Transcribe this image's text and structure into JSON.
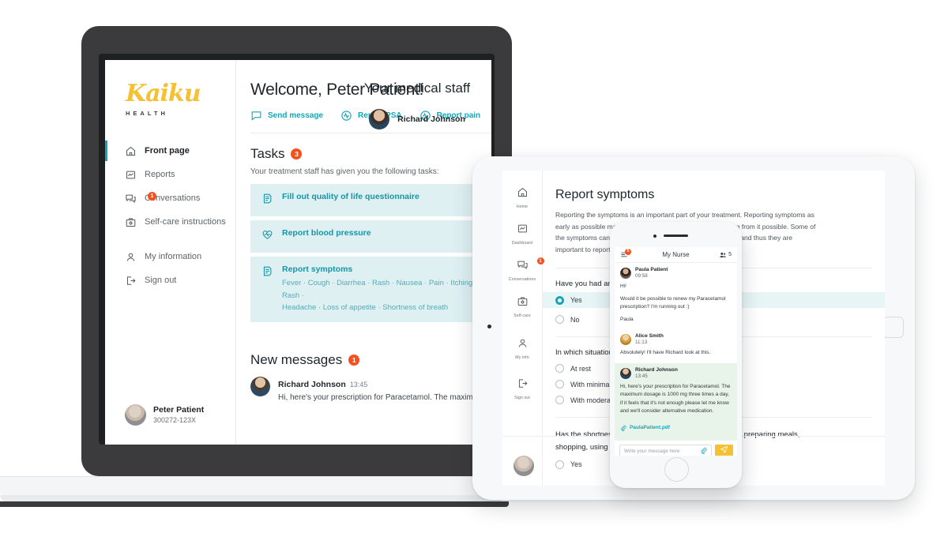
{
  "desktop": {
    "logo": {
      "name": "Kaiku",
      "sub": "HEALTH"
    },
    "nav": [
      {
        "label": "Front page",
        "icon": "home-icon",
        "active": true
      },
      {
        "label": "Reports",
        "icon": "chart-icon",
        "active": false
      },
      {
        "label": "Conversations",
        "icon": "chat-icon",
        "badge": "1",
        "active": false
      },
      {
        "label": "Self-care instructions",
        "icon": "briefcase-icon",
        "active": false
      },
      {
        "label": "My information",
        "icon": "person-icon",
        "active": false
      },
      {
        "label": "Sign out",
        "icon": "signout-icon",
        "active": false
      }
    ],
    "user": {
      "name": "Peter Patient",
      "id": "300272-123X"
    },
    "title": "Welcome, Peter Patient!",
    "actions": [
      {
        "label": "Send message",
        "icon": "message-icon"
      },
      {
        "label": "Report PSA",
        "icon": "pulse-icon"
      },
      {
        "label": "Report pain",
        "icon": "pulse-icon"
      }
    ],
    "tasks_section": {
      "title": "Tasks",
      "count": "3",
      "subtitle": "Your treatment staff has given you the following tasks:",
      "items": [
        {
          "name": "Fill out quality of life questionnaire",
          "icon": "document-icon",
          "symptoms": ""
        },
        {
          "name": "Report blood pressure",
          "icon": "heart-icon",
          "symptoms": ""
        },
        {
          "name": "Report symptoms",
          "icon": "document-icon",
          "symptoms": "Fever · Cough · Diarrhea · Rash · Nausea · Pain · Itching · Rash ·\nHeadache · Loss of appetite · Shortness of breath"
        }
      ]
    },
    "messages_section": {
      "title": "New messages",
      "count": "1",
      "items": [
        {
          "name": "Richard Johnson",
          "time": "13:45",
          "text": "Hi, here's your prescription for Paracetamol. The maxim"
        }
      ]
    },
    "staff_section": {
      "title": "Your medical staff",
      "members": [
        {
          "name": "Richard Johnson"
        }
      ]
    }
  },
  "tablet": {
    "nav": [
      {
        "label": "Home",
        "icon": "home-icon"
      },
      {
        "label": "Dashboard",
        "icon": "chart-icon"
      },
      {
        "label": "Conversations",
        "icon": "chat-icon",
        "badge": "1"
      },
      {
        "label": "Self-care",
        "icon": "briefcase-icon"
      },
      {
        "label": "My info",
        "icon": "person-icon"
      },
      {
        "label": "Sign out",
        "icon": "signout-icon"
      }
    ],
    "title": "Report symptoms",
    "paragraph": "Reporting the symptoms is an important part of your treatment. Reporting symptoms as early as possible makes reacting to them faster and benefiting from it possible. Some of the symptoms can be caused by cancer or from the medicine, and thus they are important to report.",
    "q1": {
      "text": "Have you had any shortness of breath?",
      "options": [
        {
          "label": "Yes",
          "selected": true
        },
        {
          "label": "No",
          "selected": false
        }
      ]
    },
    "q2": {
      "text": "In which situations have you had shortness of breath?",
      "options": [
        {
          "label": "At rest",
          "selected": false
        },
        {
          "label": "With minimal exertion",
          "selected": false
        },
        {
          "label": "With moderate exertion",
          "selected": false
        }
      ]
    },
    "q3": {
      "text": "Has the shortness of breath limited your daily living (e.g. preparing meals, shopping, using telephone, managing money, etc.)?",
      "options": [
        {
          "label": "Yes",
          "selected": false
        }
      ]
    }
  },
  "phone": {
    "header": {
      "title": "My Nurse",
      "people_count": "5",
      "unread_badge": "5"
    },
    "messages": [
      {
        "sender": "Paula Patient",
        "time": "09:58",
        "lines": [
          "Hi!",
          "Would it be possible to renew my Paracetamol prescription? I'm running out :)",
          "Paula"
        ],
        "own": false
      },
      {
        "sender": "Alice Smith",
        "time": "11:13",
        "lines": [
          "Absolutely! I'll have Richard look at this."
        ],
        "own": false
      },
      {
        "sender": "Richard Johnson",
        "time": "13:45",
        "lines": [
          "Hi, here's your prescription for Paracetamol. The maximum dosage is 1000 mg three times a day, if it feels that it's not enough please let me know and we'll consider alternative medication."
        ],
        "attachment": "PaulaPatient.pdf",
        "own": true
      }
    ],
    "composer": {
      "placeholder": "Write your message here",
      "attach_icon": "paperclip-icon",
      "send_icon": "send-icon"
    },
    "nav": [
      {
        "icon": "home-icon",
        "active": false
      },
      {
        "icon": "chart-icon",
        "active": false
      },
      {
        "icon": "chat-icon",
        "active": true
      },
      {
        "icon": "briefcase-icon",
        "active": false
      },
      {
        "icon": "person-icon",
        "active": false
      }
    ]
  },
  "colors": {
    "teal": "#14a6b8",
    "orange": "#f4511e",
    "yellow": "#f6c033",
    "task_bg": "#dff0f2",
    "own_msg_bg": "#e8f3e9"
  }
}
